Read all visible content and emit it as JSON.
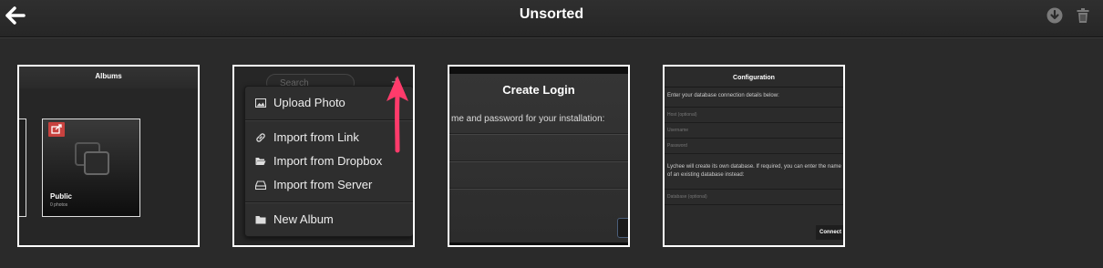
{
  "header": {
    "title": "Unsorted",
    "back_icon": "arrow-left-icon",
    "download_icon": "download-circle-icon",
    "delete_icon": "trash-icon"
  },
  "thumbnails": [
    {
      "header": "Albums",
      "album": {
        "name": "Public",
        "count": "0 photos",
        "share_color": "#c8423f"
      }
    },
    {
      "search_placeholder": "Search",
      "plus_label": "+",
      "menu": [
        {
          "label": "Upload Photo",
          "icon": "image-icon"
        },
        {
          "label": "Import from Link",
          "icon": "link-icon"
        },
        {
          "label": "Import from Dropbox",
          "icon": "folder-open-icon"
        },
        {
          "label": "Import from Server",
          "icon": "server-icon"
        },
        {
          "label": "New Album",
          "icon": "folder-icon"
        }
      ],
      "arrow_color": "#ff3b6b"
    },
    {
      "title": "Create Login",
      "text": "me and password for your installation:"
    },
    {
      "title": "Configuration",
      "intro": "Enter your database connection details below:",
      "fields": [
        "Host (optional)",
        "Username",
        "Password"
      ],
      "note": "Lychee will create its own database. If required, you can enter the name of an existing database instead:",
      "db_field": "Database (optional)",
      "connect": "Connect"
    }
  ]
}
